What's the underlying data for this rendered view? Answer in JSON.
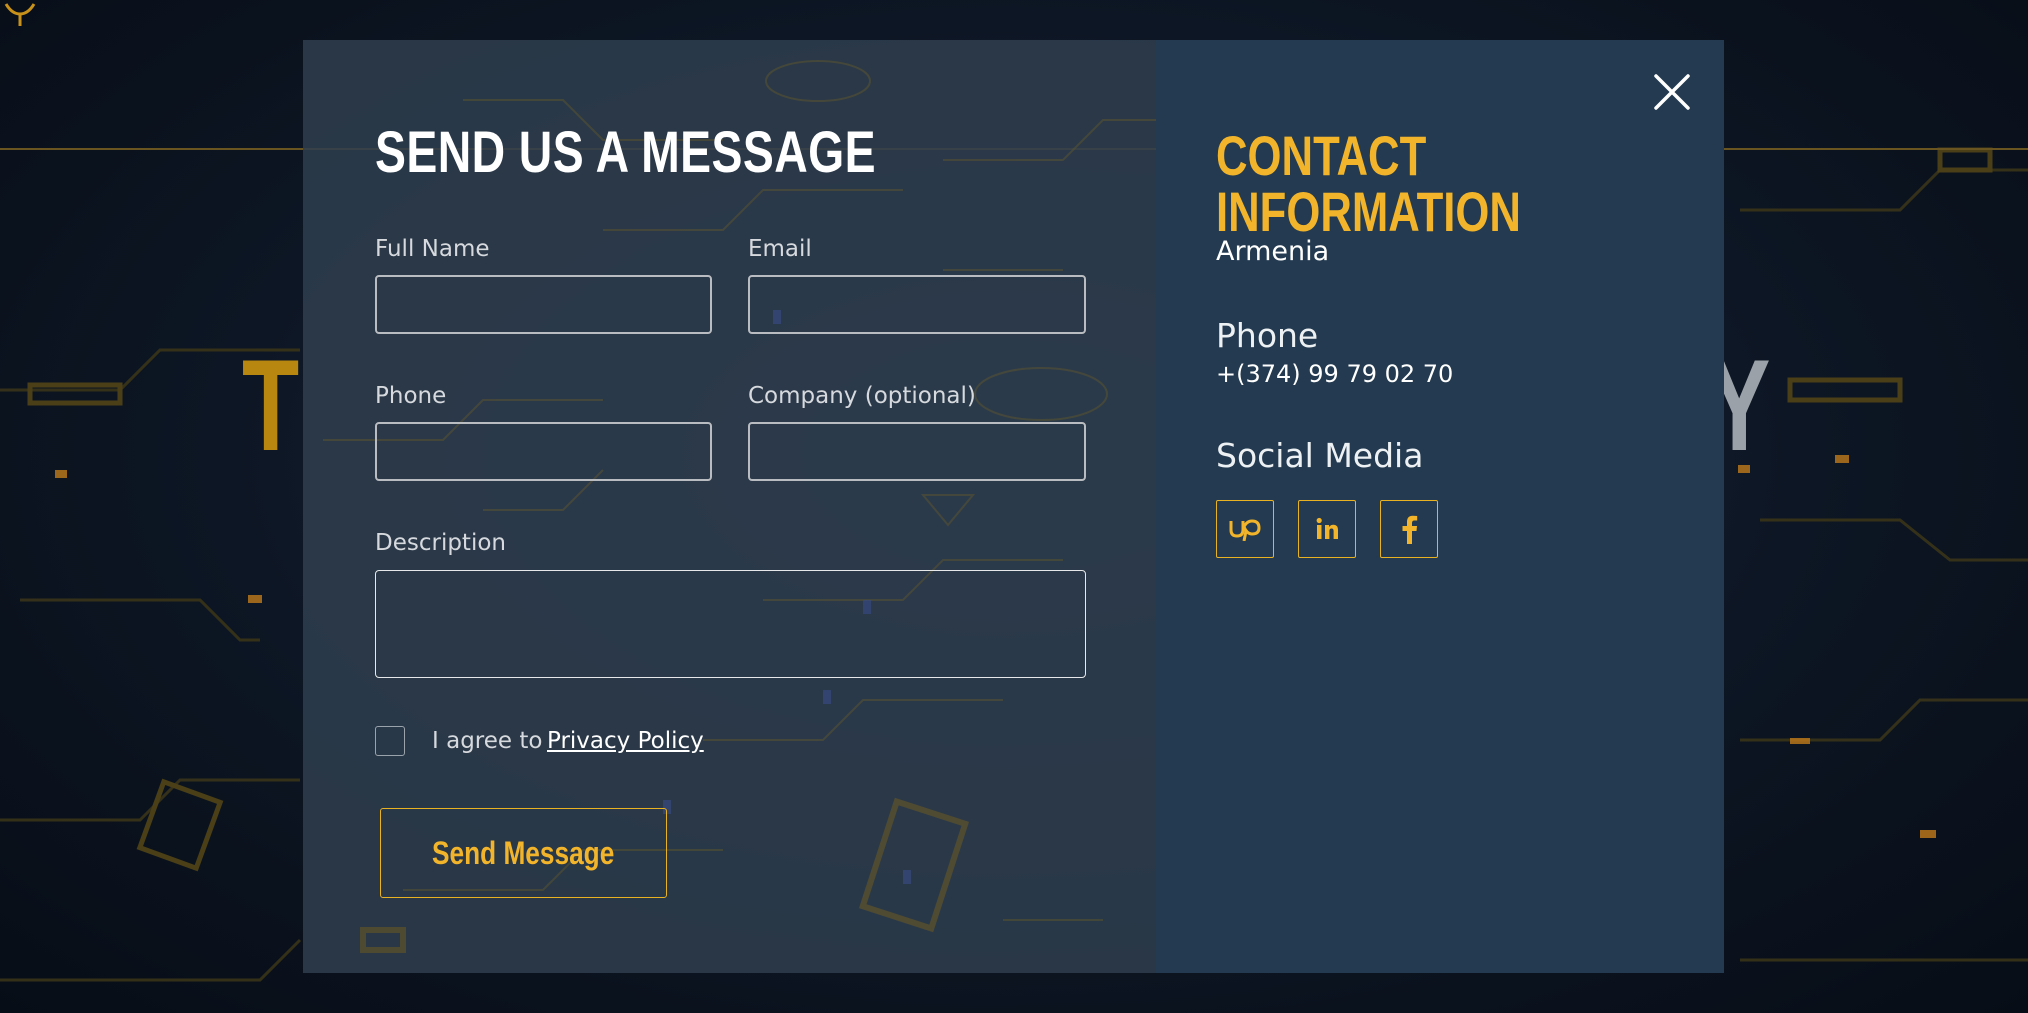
{
  "background": {
    "hero_left": "T",
    "hero_right": "Y"
  },
  "form": {
    "title": "SEND US A MESSAGE",
    "full_name_label": "Full Name",
    "full_name_value": "",
    "email_label": "Email",
    "email_value": "",
    "phone_label": "Phone",
    "phone_value": "",
    "company_label": "Company (optional)",
    "company_value": "",
    "description_label": "Description",
    "description_value": "",
    "agree_text": "I agree to",
    "privacy_link": "Privacy Policy",
    "agree_checked": false,
    "submit_label": "Send Message"
  },
  "contact": {
    "title": "CONTACT INFORMATION",
    "location": "Armenia",
    "phone_heading": "Phone",
    "phone_number": "+(374) 99 79 02 70",
    "social_heading": "Social Media",
    "social": [
      {
        "name": "upwork",
        "icon": "upwork-icon"
      },
      {
        "name": "linkedin",
        "icon": "linkedin-icon"
      },
      {
        "name": "facebook",
        "icon": "facebook-icon"
      }
    ]
  },
  "colors": {
    "accent": "#f2b42a",
    "form_panel": "#2e3e4e",
    "info_panel": "#233a50",
    "page_bg": "#0b1320"
  },
  "icons": {
    "close": "close-icon"
  }
}
